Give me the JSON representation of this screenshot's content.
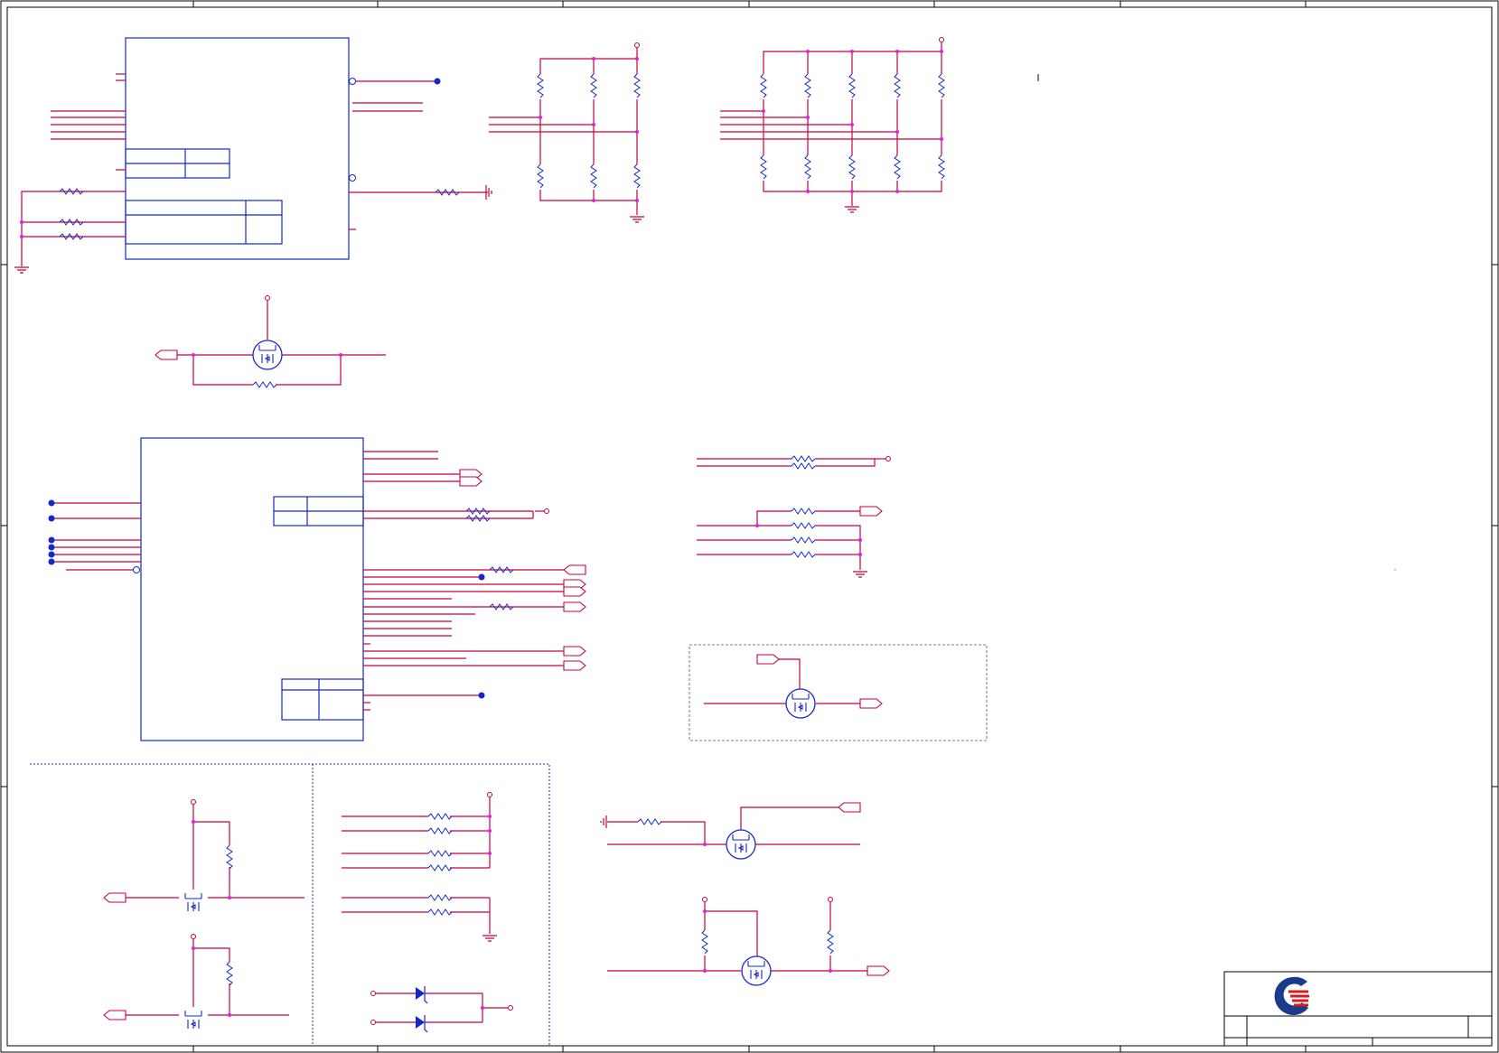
{
  "colors": {
    "wire": "#c8003c",
    "symbol": "#1428c8",
    "border": "#000000",
    "junction": "#e020e0",
    "logo_blue": "#1a3a8c",
    "logo_red": "#d21e1e"
  },
  "icons": {
    "logo": "company-logo-icon",
    "mosfet": "mosfet-icon",
    "resistor": "resistor-icon",
    "ground": "ground-icon",
    "diode": "diode-icon",
    "power": "power-pin-icon"
  }
}
